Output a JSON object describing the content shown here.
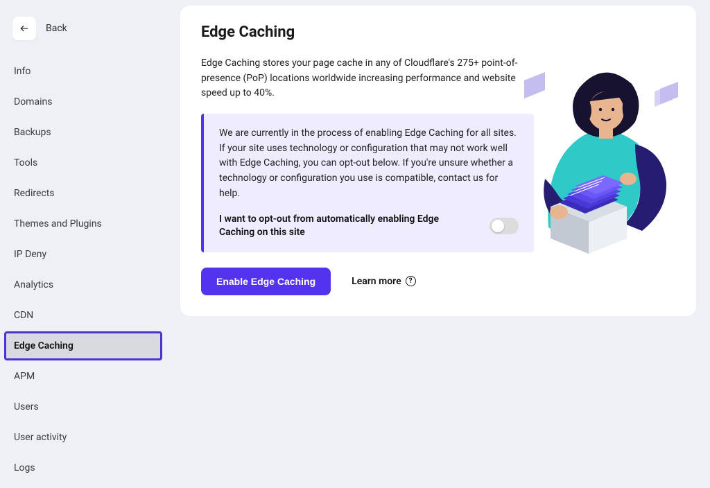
{
  "back": {
    "label": "Back"
  },
  "sidebar": {
    "items": [
      {
        "label": "Info"
      },
      {
        "label": "Domains"
      },
      {
        "label": "Backups"
      },
      {
        "label": "Tools"
      },
      {
        "label": "Redirects"
      },
      {
        "label": "Themes and Plugins"
      },
      {
        "label": "IP Deny"
      },
      {
        "label": "Analytics"
      },
      {
        "label": "CDN"
      },
      {
        "label": "Edge Caching"
      },
      {
        "label": "APM"
      },
      {
        "label": "Users"
      },
      {
        "label": "User activity"
      },
      {
        "label": "Logs"
      }
    ],
    "active_index": 9
  },
  "page": {
    "title": "Edge Caching",
    "description": "Edge Caching stores your page cache in any of Cloudflare's 275+ point-of-presence (PoP) locations worldwide increasing performance and website speed up to 40%.",
    "notice_text": "We are currently in the process of enabling Edge Caching for all sites. If your site uses technology or configuration that may not work well with Edge Caching, you can opt-out below. If you're unsure whether a technology or configuration you use is compatible, contact us for help.",
    "opt_out_label": "I want to opt-out from automatically enabling Edge Caching on this site",
    "opt_out_value": false,
    "enable_button": "Enable Edge Caching",
    "learn_more": "Learn more"
  }
}
